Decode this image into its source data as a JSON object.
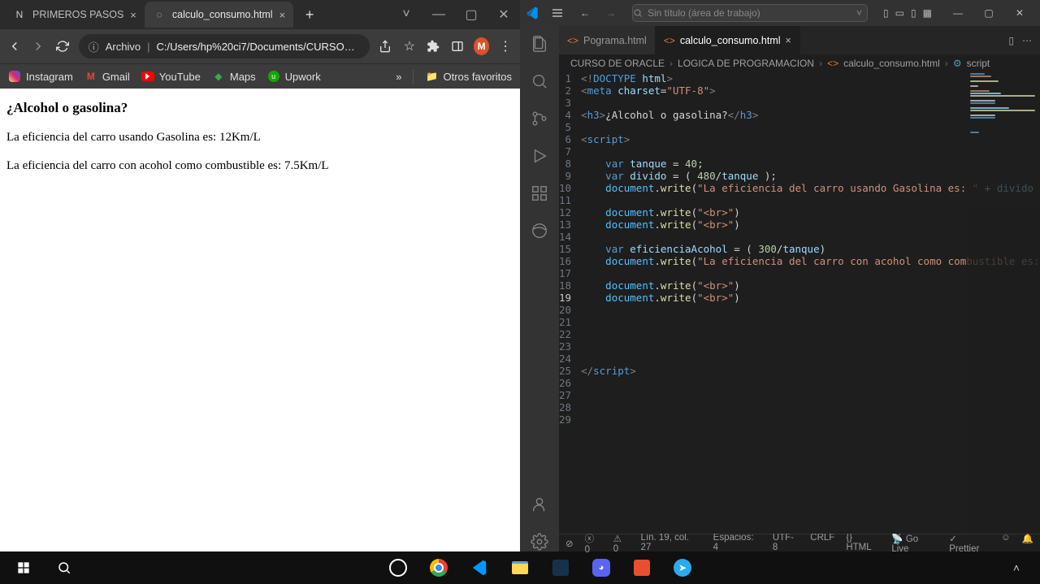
{
  "chrome": {
    "tabs": [
      {
        "title": "PRIMEROS PASOS",
        "active": false
      },
      {
        "title": "calculo_consumo.html",
        "active": true
      }
    ],
    "address": {
      "protocol_label": "Archivo",
      "url": "C:/Users/hp%20ci7/Documents/CURSO%..."
    },
    "profile_initial": "M",
    "bookmarks": {
      "items": [
        {
          "label": "Instagram"
        },
        {
          "label": "Gmail"
        },
        {
          "label": "YouTube"
        },
        {
          "label": "Maps"
        },
        {
          "label": "Upwork"
        }
      ],
      "overflow": "»",
      "other": "Otros favoritos"
    },
    "page": {
      "heading": "¿Alcohol o gasolina?",
      "line1": "La eficiencia del carro usando Gasolina es: 12Km/L",
      "line2": "La eficiencia del carro con acohol como combustible es: 7.5Km/L"
    }
  },
  "vscode": {
    "command_center": "Sin título (área de trabajo)",
    "tabs": [
      {
        "label": "Pograma.html",
        "active": false
      },
      {
        "label": "calculo_consumo.html",
        "active": true
      }
    ],
    "crumbs": {
      "c1": "CURSO DE ORACLE",
      "c2": "LOGICA DE PROGRAMACION",
      "c3": "calculo_consumo.html",
      "c4": "script"
    },
    "code_lines": [
      "<!DOCTYPE html>",
      "<meta charset=\"UTF-8\">",
      "",
      "<h3>¿Alcohol o gasolina?</h3>",
      "",
      "<script>",
      "",
      "    var tanque = 40;",
      "    var divido = ( 480/tanque );",
      "    document.write(\"La eficiencia del carro usando Gasolina es: \" + divido + ",
      "",
      "    document.write(\"<br>\")",
      "    document.write(\"<br>\")",
      "",
      "    var eficienciaAcohol = ( 300/tanque)",
      "    document.write(\"La eficiencia del carro con acohol como combustible es: \"          :A",
      "",
      "    document.write(\"<br>\")",
      "    document.write(\"<br>\")",
      "",
      "",
      "",
      "",
      "",
      "</script>",
      "",
      "",
      "",
      ""
    ],
    "status": {
      "errors": "0",
      "warnings": "0",
      "cursor": "Lín. 19, col. 27",
      "spaces": "Espacios: 4",
      "encoding": "UTF-8",
      "eol": "CRLF",
      "lang_icon": "{}",
      "lang": "HTML",
      "golive": "Go Live",
      "prettier": "Prettier"
    }
  }
}
